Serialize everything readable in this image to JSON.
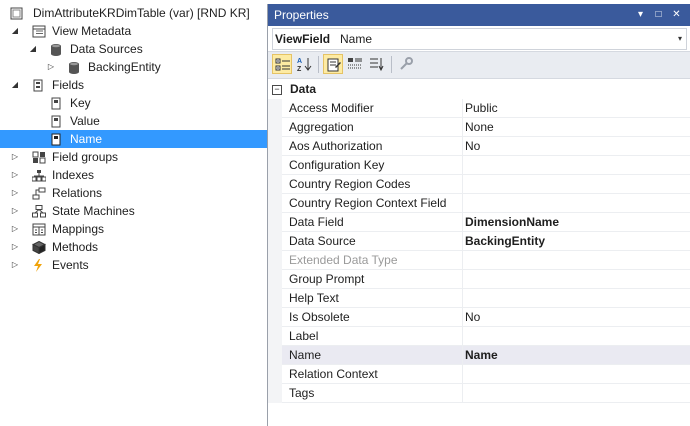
{
  "tree": {
    "nodes": [
      {
        "label": "DimAttributeKRDimTable (var) [RND KR]",
        "expander": "",
        "icon": "table-icon",
        "selected": false
      },
      {
        "label": "View Metadata",
        "expander": "◢",
        "icon": "metadata-icon",
        "selected": false
      },
      {
        "label": "Data Sources",
        "expander": "◢",
        "icon": "database-icon",
        "selected": false
      },
      {
        "label": "BackingEntity",
        "expander": "▷",
        "icon": "database-icon",
        "selected": false
      },
      {
        "label": "Fields",
        "expander": "◢",
        "icon": "fields-icon",
        "selected": false
      },
      {
        "label": "Key",
        "expander": "",
        "icon": "field-icon",
        "selected": false
      },
      {
        "label": "Value",
        "expander": "",
        "icon": "field-icon",
        "selected": false
      },
      {
        "label": "Name",
        "expander": "",
        "icon": "field-icon",
        "selected": true
      },
      {
        "label": "Field groups",
        "expander": "▷",
        "icon": "field-groups-icon",
        "selected": false
      },
      {
        "label": "Indexes",
        "expander": "▷",
        "icon": "indexes-icon",
        "selected": false
      },
      {
        "label": "Relations",
        "expander": "▷",
        "icon": "relations-icon",
        "selected": false
      },
      {
        "label": "State Machines",
        "expander": "▷",
        "icon": "state-machines-icon",
        "selected": false
      },
      {
        "label": "Mappings",
        "expander": "▷",
        "icon": "mappings-icon",
        "selected": false
      },
      {
        "label": "Methods",
        "expander": "▷",
        "icon": "methods-icon",
        "selected": false
      },
      {
        "label": "Events",
        "expander": "▷",
        "icon": "events-icon",
        "selected": false
      }
    ]
  },
  "properties": {
    "title": "Properties",
    "title_buttons": {
      "dropdown": "▾",
      "maximize": "□",
      "close": "✕"
    },
    "object_name": "ViewField",
    "object_type": "Name",
    "object_dropdown": "▾",
    "category": {
      "label": "Data",
      "collapse": "−"
    },
    "rows": [
      {
        "name": "Access Modifier",
        "value": "Public",
        "bold": false,
        "disabled": false
      },
      {
        "name": "Aggregation",
        "value": "None",
        "bold": false,
        "disabled": false
      },
      {
        "name": "Aos Authorization",
        "value": "No",
        "bold": false,
        "disabled": false
      },
      {
        "name": "Configuration Key",
        "value": "",
        "bold": false,
        "disabled": false
      },
      {
        "name": "Country Region Codes",
        "value": "",
        "bold": false,
        "disabled": false
      },
      {
        "name": "Country Region Context Field",
        "value": "",
        "bold": false,
        "disabled": false
      },
      {
        "name": "Data Field",
        "value": "DimensionName",
        "bold": true,
        "disabled": false
      },
      {
        "name": "Data Source",
        "value": "BackingEntity",
        "bold": true,
        "disabled": false
      },
      {
        "name": "Extended Data Type",
        "value": "",
        "bold": false,
        "disabled": true
      },
      {
        "name": "Group Prompt",
        "value": "",
        "bold": false,
        "disabled": false
      },
      {
        "name": "Help Text",
        "value": "",
        "bold": false,
        "disabled": false
      },
      {
        "name": "Is Obsolete",
        "value": "No",
        "bold": false,
        "disabled": false
      },
      {
        "name": "Label",
        "value": "",
        "bold": false,
        "disabled": false
      },
      {
        "name": "Name",
        "value": "Name",
        "bold": true,
        "disabled": false,
        "highlight": true
      },
      {
        "name": "Relation Context",
        "value": "",
        "bold": false,
        "disabled": false
      },
      {
        "name": "Tags",
        "value": "",
        "bold": false,
        "disabled": false
      }
    ]
  },
  "colors": {
    "selection": "#3399ff",
    "title_bar": "#3a5a9c",
    "toolbar_active": "#fdeba3"
  }
}
